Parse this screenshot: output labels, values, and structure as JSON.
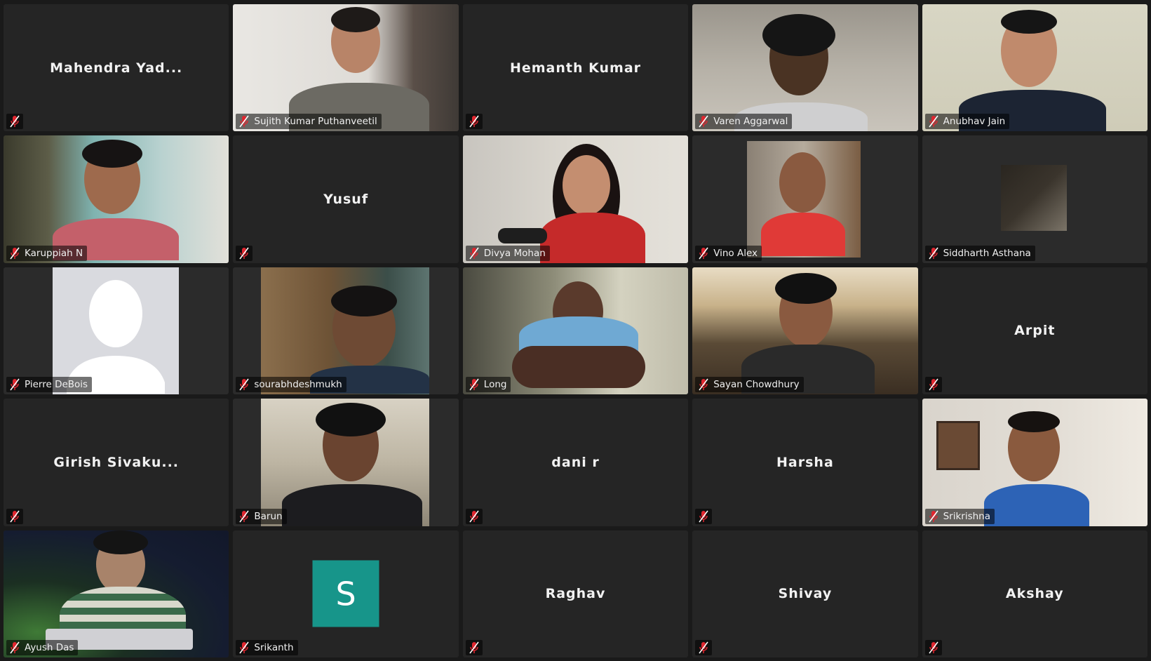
{
  "participants": [
    {
      "name": "Mahendra Yad...",
      "video": false
    },
    {
      "name": "Sujith Kumar Puthanveetil",
      "video": true
    },
    {
      "name": "Hemanth Kumar",
      "video": false
    },
    {
      "name": "Varen Aggarwal",
      "video": true
    },
    {
      "name": "Anubhav Jain",
      "video": true
    },
    {
      "name": "Karuppiah N",
      "video": true
    },
    {
      "name": "Yusuf",
      "video": false
    },
    {
      "name": "Divya Mohan",
      "video": true
    },
    {
      "name": "Vino Alex",
      "video": true
    },
    {
      "name": "Siddharth Asthana",
      "video": true
    },
    {
      "name": "Pierre DeBois",
      "video": true
    },
    {
      "name": "sourabhdeshmukh",
      "video": true
    },
    {
      "name": "Long",
      "video": true
    },
    {
      "name": "Sayan Chowdhury",
      "video": true
    },
    {
      "name": "Arpit",
      "video": false
    },
    {
      "name": "Girish Sivaku...",
      "video": false
    },
    {
      "name": "Barun",
      "video": true
    },
    {
      "name": "dani r",
      "video": false
    },
    {
      "name": "Harsha",
      "video": false
    },
    {
      "name": "Srikrishna",
      "video": true
    },
    {
      "name": "Ayush Das",
      "video": true
    },
    {
      "name": "Srikanth",
      "video": false,
      "avatar_initial": "S"
    },
    {
      "name": "Raghav",
      "video": false
    },
    {
      "name": "Shivay",
      "video": false
    },
    {
      "name": "Akshay",
      "video": false
    }
  ],
  "colors": {
    "background": "#1a1a1a",
    "tile": "#252525",
    "muted_icon": "#e0262f",
    "avatar_initial_bg": "#17958a"
  }
}
